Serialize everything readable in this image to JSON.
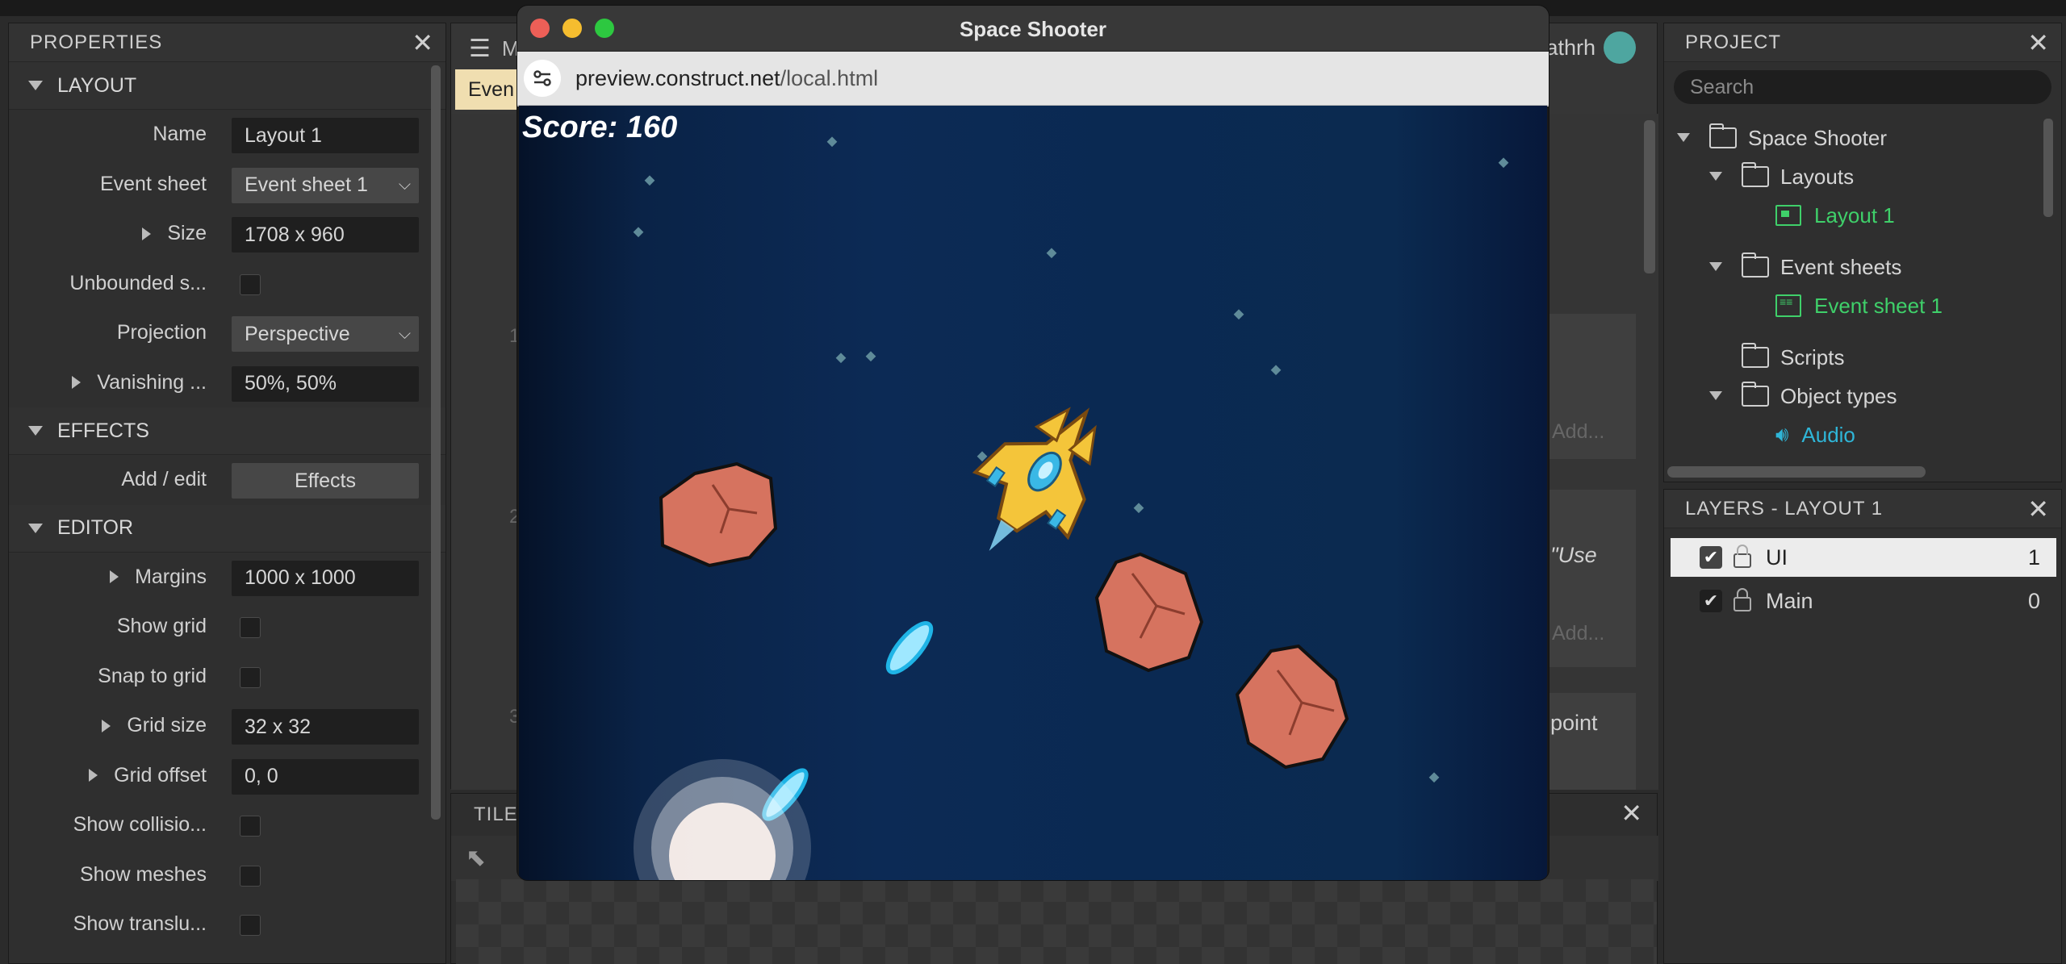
{
  "properties": {
    "title": "PROPERTIES",
    "sections": {
      "layout": "LAYOUT",
      "effects": "EFFECTS",
      "editor": "EDITOR"
    },
    "rows": {
      "name": {
        "label": "Name",
        "value": "Layout 1"
      },
      "event_sheet": {
        "label": "Event sheet",
        "value": "Event sheet 1"
      },
      "size": {
        "label": "Size",
        "value": "1708 x 960"
      },
      "unbounded": {
        "label": "Unbounded s..."
      },
      "projection": {
        "label": "Projection",
        "value": "Perspective"
      },
      "vanishing": {
        "label": "Vanishing ...",
        "value": "50%, 50%"
      },
      "add_edit": {
        "label": "Add / edit",
        "value": "Effects"
      },
      "margins": {
        "label": "Margins",
        "value": "1000 x 1000"
      },
      "show_grid": {
        "label": "Show grid"
      },
      "snap_grid": {
        "label": "Snap to grid"
      },
      "grid_size": {
        "label": "Grid size",
        "value": "32 x 32"
      },
      "grid_offset": {
        "label": "Grid offset",
        "value": "0, 0"
      },
      "show_collision": {
        "label": "Show collisio..."
      },
      "show_meshes": {
        "label": "Show meshes"
      },
      "show_translucent": {
        "label": "Show translu..."
      }
    }
  },
  "editor": {
    "menu_letter": "M",
    "tab_label": "Even",
    "user_name": ".athrh",
    "event_numbers": [
      "1",
      "2",
      "3"
    ],
    "event_texts": [
      "\"Use",
      "point"
    ],
    "add_label": "Add...",
    "tiles_title": "TILE"
  },
  "preview": {
    "window_title": "Space Shooter",
    "url_host": "preview.construct.net",
    "url_path": "/local.html",
    "score": "Score: 160"
  },
  "project": {
    "title": "PROJECT",
    "search_placeholder": "Search",
    "tree": {
      "root": "Space Shooter",
      "layouts": "Layouts",
      "layout1": "Layout 1",
      "event_sheets": "Event sheets",
      "event_sheet1": "Event sheet 1",
      "scripts": "Scripts",
      "object_types": "Object types",
      "audio": "Audio"
    }
  },
  "layers": {
    "title": "LAYERS - LAYOUT 1",
    "items": [
      {
        "name": "UI",
        "index": "1"
      },
      {
        "name": "Main",
        "index": "0"
      }
    ]
  },
  "colors": {
    "green_accent": "#3fd06a",
    "blue_accent": "#2fb6d8"
  }
}
